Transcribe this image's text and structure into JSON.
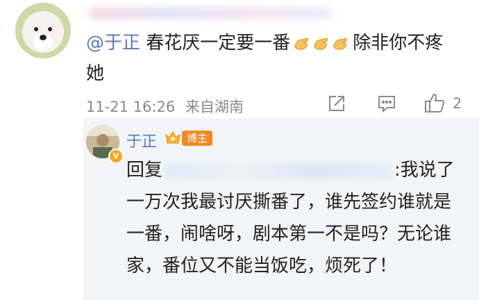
{
  "comment": {
    "mention": "@于正",
    "text_part1": "春花厌一定要一番",
    "emoji_icon": "clapping-hands-icon",
    "text_part2": "除非你不疼她",
    "date": "11-21 16:26",
    "location": "来自湖南",
    "like_count": "2"
  },
  "reply": {
    "author": "于正",
    "badge": "博主",
    "prefix": "回复",
    "text_first_line_end": ":我说",
    "text_rest": "了一万次我最讨厌撕番了，谁先签约谁就是一番，闹啥呀，剧本第一不是吗？无论谁家，番位又不能当饭吃，烦死了！"
  },
  "colors": {
    "link_blue": "#5b79b8",
    "meta_gray": "#8a8a8a",
    "badge_orange": "#f08a24",
    "reply_bg": "#f3f4f6"
  }
}
